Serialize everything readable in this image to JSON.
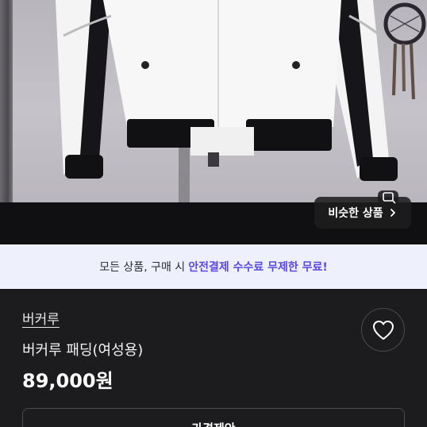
{
  "photo": {
    "icons": {
      "product_image": "white-padded-jacket-photo",
      "decor": "dreamcatcher",
      "similar_icon": "image-search-icon",
      "chevron": "chevron-right-icon"
    },
    "similar_button_label": "비슷한 상품"
  },
  "promo": {
    "prefix": "모든 상품, 구매 시",
    "highlight": "안전결제 수수료 무제한 무료!",
    "accent_color": "#5b48e8"
  },
  "product": {
    "brand": "버커루",
    "title": "버커루 패딩(여성용)",
    "price": "89,000원",
    "like_icon": "heart-outline-icon",
    "offer_button_label": "가격제안"
  }
}
